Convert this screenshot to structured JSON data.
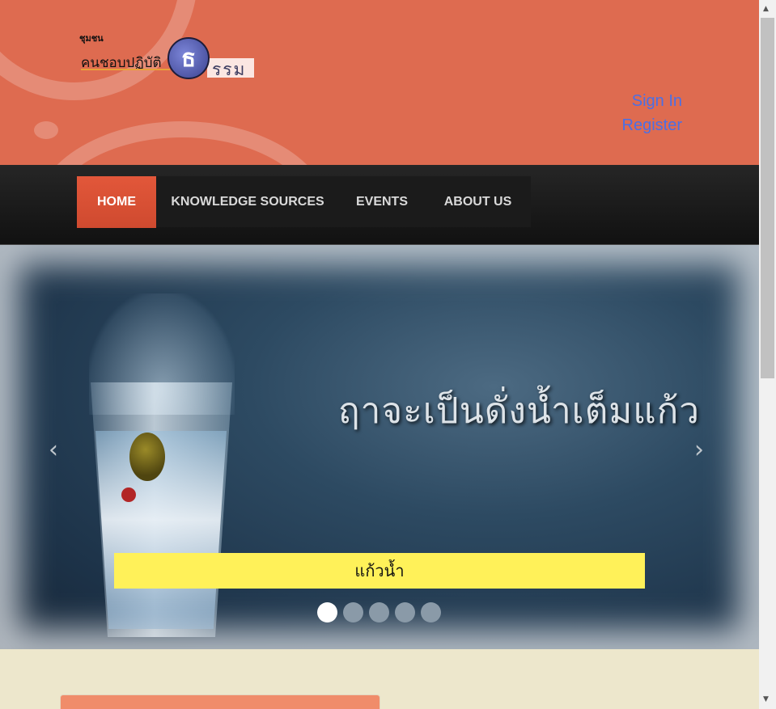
{
  "header": {
    "logo": {
      "small_text": "ชุมชน",
      "main_text": "คนชอบปฏิบัติ",
      "circle_letter": "ธ",
      "tail_text": "รรม"
    },
    "auth": {
      "sign_in": "Sign In",
      "register": "Register"
    }
  },
  "nav": {
    "items": [
      {
        "label": "HOME",
        "active": true
      },
      {
        "label": "KNOWLEDGE SOURCES",
        "active": false
      },
      {
        "label": "EVENTS",
        "active": false
      },
      {
        "label": "ABOUT US",
        "active": false
      }
    ]
  },
  "slider": {
    "headline": "ฤาจะเป็นดั่งน้ำเต็มแก้ว",
    "caption": "แก้วน้ำ",
    "prev_icon": "‹",
    "next_icon": "›",
    "slide_count": 5,
    "active_index": 0
  },
  "colors": {
    "header_bg": "#de6b50",
    "nav_active": "#e2573a",
    "caption_bg": "#fff159",
    "page_bg": "#ede7cc",
    "link": "#4a6fe6"
  }
}
